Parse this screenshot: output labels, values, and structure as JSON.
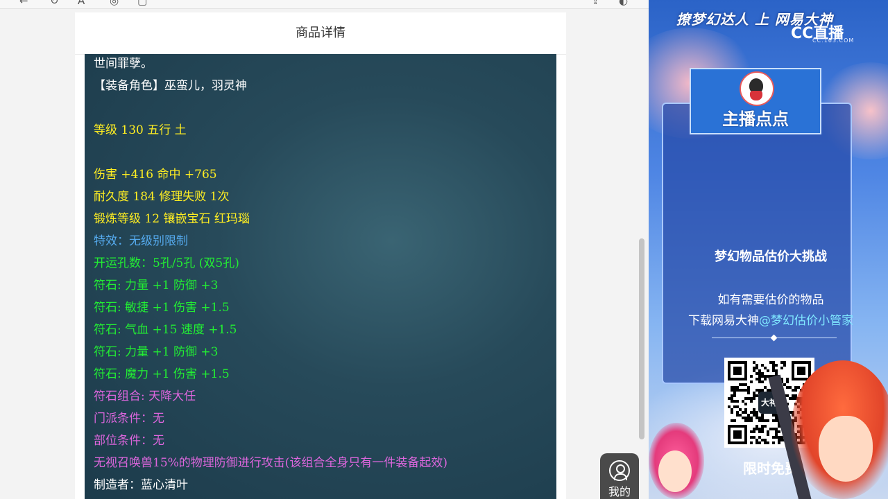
{
  "page": {
    "title": "商品详情"
  },
  "detail_lines": [
    {
      "text": "世间罪孽。",
      "color": "#ffffff"
    },
    {
      "text": "【装备角色】巫蛮儿，羽灵神",
      "color": "#ffffff"
    },
    {
      "text": "",
      "color": "#ffffff"
    },
    {
      "text": "等级 130 五行 土",
      "color": "#ffee22"
    },
    {
      "text": "",
      "color": "#ffee22"
    },
    {
      "text": "伤害 +416 命中 +765",
      "color": "#ffee22"
    },
    {
      "text": "耐久度 184 修理失败 1次",
      "color": "#ffee22"
    },
    {
      "text": "锻炼等级 12 镶嵌宝石 红玛瑙",
      "color": "#ffee22"
    },
    {
      "text": "特效：无级别限制",
      "color": "#55aaee"
    },
    {
      "text": "开运孔数：5孔/5孔 (双5孔)",
      "color": "#22ee33"
    },
    {
      "text": "符石: 力量 +1 防御 +3",
      "color": "#22ee33"
    },
    {
      "text": "符石: 敏捷 +1 伤害 +1.5",
      "color": "#22ee33"
    },
    {
      "text": "符石: 气血 +15 速度 +1.5",
      "color": "#22ee33"
    },
    {
      "text": "符石: 力量 +1 防御 +3",
      "color": "#22ee33"
    },
    {
      "text": "符石: 魔力 +1 伤害 +1.5",
      "color": "#22ee33"
    },
    {
      "text": "符石组合: 天降大任",
      "color": "#dd66dd"
    },
    {
      "text": "门派条件：无",
      "color": "#dd66dd"
    },
    {
      "text": "部位条件：无",
      "color": "#dd66dd"
    },
    {
      "text": "无视召唤兽15%的物理防御进行攻击(该组合全身只有一件装备起效)",
      "color": "#dd66dd"
    },
    {
      "text": "制造者：蓝心清叶",
      "color": "#ffffff"
    }
  ],
  "floating": {
    "my_label": "我的",
    "icon": "person-icon"
  },
  "toolbar": {
    "icons": [
      "back-icon",
      "refresh-icon",
      "text-size-icon",
      "screenshot-icon",
      "copy-icon",
      "share-icon",
      "settings-icon"
    ]
  },
  "ad": {
    "slogan": "撩梦幻达人 上 网易大神",
    "cc_logo": "CC直播",
    "cc_url": "CC.163.COM",
    "anchor_name": "主播点点",
    "headline": "梦幻物品估价大挑战",
    "line1": "如有需要估价的物品",
    "line2_prefix": "下载网易大神",
    "line2_mention": "@梦幻估价小管家",
    "qr_center": "大神",
    "footer": "限时免费"
  }
}
